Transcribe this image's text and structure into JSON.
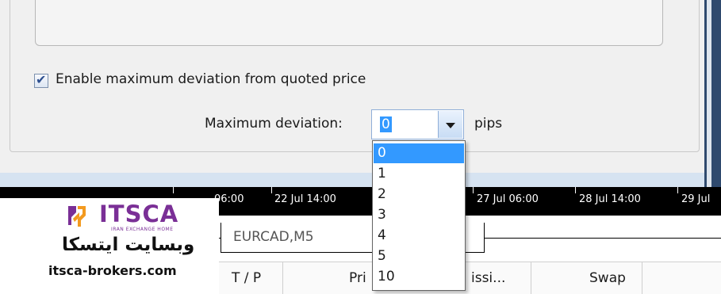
{
  "dialog": {
    "enable_deviation_label": "Enable maximum deviation from quoted price",
    "enable_deviation_checked": true,
    "max_deviation_label": "Maximum deviation:",
    "max_deviation_value": "0",
    "unit_label": "pips",
    "options": [
      "0",
      "1",
      "2",
      "3",
      "4",
      "5",
      "10"
    ],
    "selected_option": "0"
  },
  "chart_axis": {
    "ticks": [
      "06:00",
      "22 Jul 14:00",
      "27 Jul 06:00",
      "28 Jul 14:00",
      "29 Jul"
    ]
  },
  "tabs": [
    {
      "label": "EURCAD,M5"
    }
  ],
  "table": {
    "columns": [
      "T / P",
      "Pri",
      "issi...",
      "Swap"
    ]
  },
  "watermark": {
    "brand": "ITSCA",
    "tagline": "IRAN EXCHANGE HOME",
    "arabic_text": "وبسایت ایتسکا",
    "url": "itsca-brokers.com"
  },
  "colors": {
    "selection": "#3399ff",
    "brand_purple": "#7a2f96",
    "brand_orange": "#f39a1f",
    "window_frame": "#2b5283"
  }
}
